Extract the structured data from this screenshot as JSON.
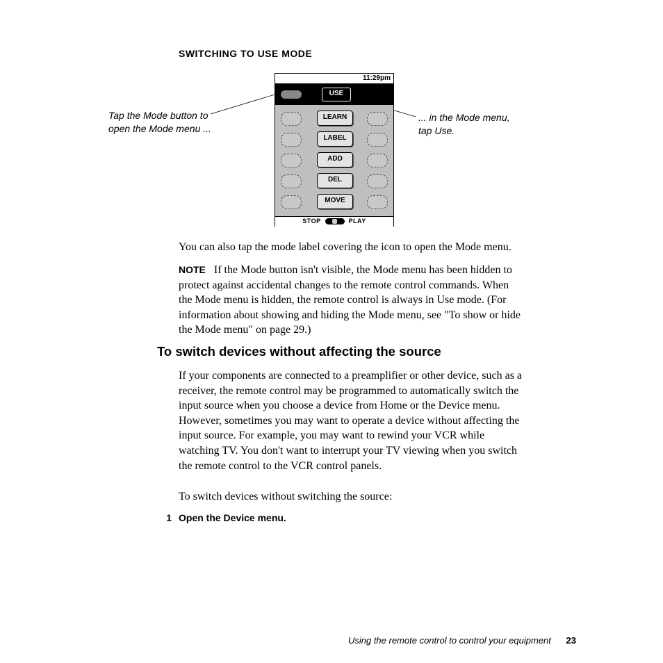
{
  "section_title": "SWITCHING TO USE MODE",
  "callouts": {
    "left": "Tap the Mode button to open the Mode menu ...",
    "right": "... in the Mode menu, tap Use."
  },
  "figure": {
    "time": "11:29pm",
    "mode_buttons": [
      "USE",
      "LEARN",
      "LABEL",
      "ADD",
      "DEL",
      "MOVE"
    ],
    "bottom_left": "STOP",
    "bottom_right": "PLAY"
  },
  "para1": "You can also tap the mode label covering the icon to open the Mode menu.",
  "note_label": "NOTE",
  "note_body": "If the Mode button isn't visible, the Mode menu has been hidden to protect against accidental changes to the remote control commands. When the Mode menu is hidden, the remote control is always in Use mode. (For information about showing and hiding the Mode menu, see \"To show or hide the Mode menu\" on page 29.)",
  "h2": "To switch devices without affecting the source",
  "para2": "If your components are connected to a preamplifier or other device, such as a receiver, the remote control may be programmed to automatically switch the input source when you choose a device from Home or the Device menu. However, sometimes you may want to operate a device without affecting the input source. For example, you may want to rewind your VCR while watching TV. You don't want to interrupt your TV viewing when you switch the remote control to the VCR control panels.",
  "para3": "To switch devices without switching the source:",
  "step1_num": "1",
  "step1_text": "Open the Device menu.",
  "footer_text": "Using the remote control to control your equipment",
  "page_number": "23"
}
